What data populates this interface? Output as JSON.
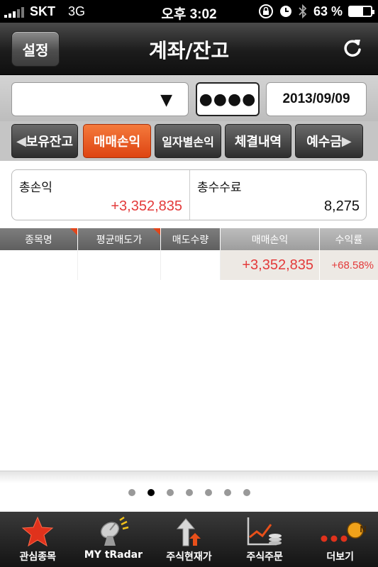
{
  "status_bar": {
    "carrier": "SKT",
    "network": "3G",
    "time": "오후 3:02",
    "battery_percent": "63 %",
    "battery_level": 0.63
  },
  "header": {
    "settings_label": "설정",
    "title": "계좌/잔고"
  },
  "filters": {
    "account_value": "",
    "password_mask": "●●●●",
    "date": "2013/09/09"
  },
  "tabs": [
    {
      "label": "보유잔고",
      "active": false
    },
    {
      "label": "매매손익",
      "active": true
    },
    {
      "label": "일자별손익",
      "active": false
    },
    {
      "label": "체결내역",
      "active": false
    },
    {
      "label": "예수금",
      "active": false
    }
  ],
  "summary": {
    "total_profit_label": "총손익",
    "total_profit_value": "+3,352,835",
    "total_fee_label": "총수수료",
    "total_fee_value": "8,275"
  },
  "table": {
    "columns": [
      "종목명",
      "평균매도가",
      "매도수량",
      "매매손익",
      "수익률"
    ],
    "rows": [
      {
        "name": "",
        "avg_sell_price": "",
        "sell_qty": "",
        "profit": "+3,352,835",
        "return_rate": "+68.58%"
      }
    ]
  },
  "pagination": {
    "count": 7,
    "current": 2
  },
  "bottom_nav": [
    {
      "label": "관심종목",
      "icon": "star-icon"
    },
    {
      "label": "MY tRadar",
      "icon": "radar-dish-icon"
    },
    {
      "label": "주식현재가",
      "icon": "price-up-arrow-icon"
    },
    {
      "label": "주식주문",
      "icon": "chart-coins-icon"
    },
    {
      "label": "더보기",
      "icon": "more-dots-icon",
      "badge": "N"
    }
  ],
  "colors": {
    "accent": "#e04a18",
    "profit": "#e33a3a"
  }
}
